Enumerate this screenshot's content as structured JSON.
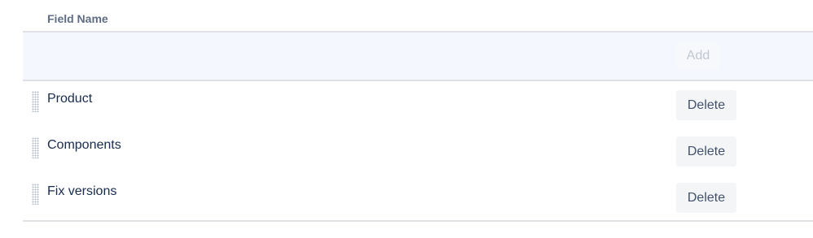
{
  "table": {
    "header": {
      "field_name": "Field Name"
    },
    "add_row": {
      "add_label": "Add",
      "input_value": ""
    },
    "rows": [
      {
        "label": "Product",
        "delete_label": "Delete"
      },
      {
        "label": "Components",
        "delete_label": "Delete"
      },
      {
        "label": "Fix versions",
        "delete_label": "Delete"
      }
    ]
  }
}
